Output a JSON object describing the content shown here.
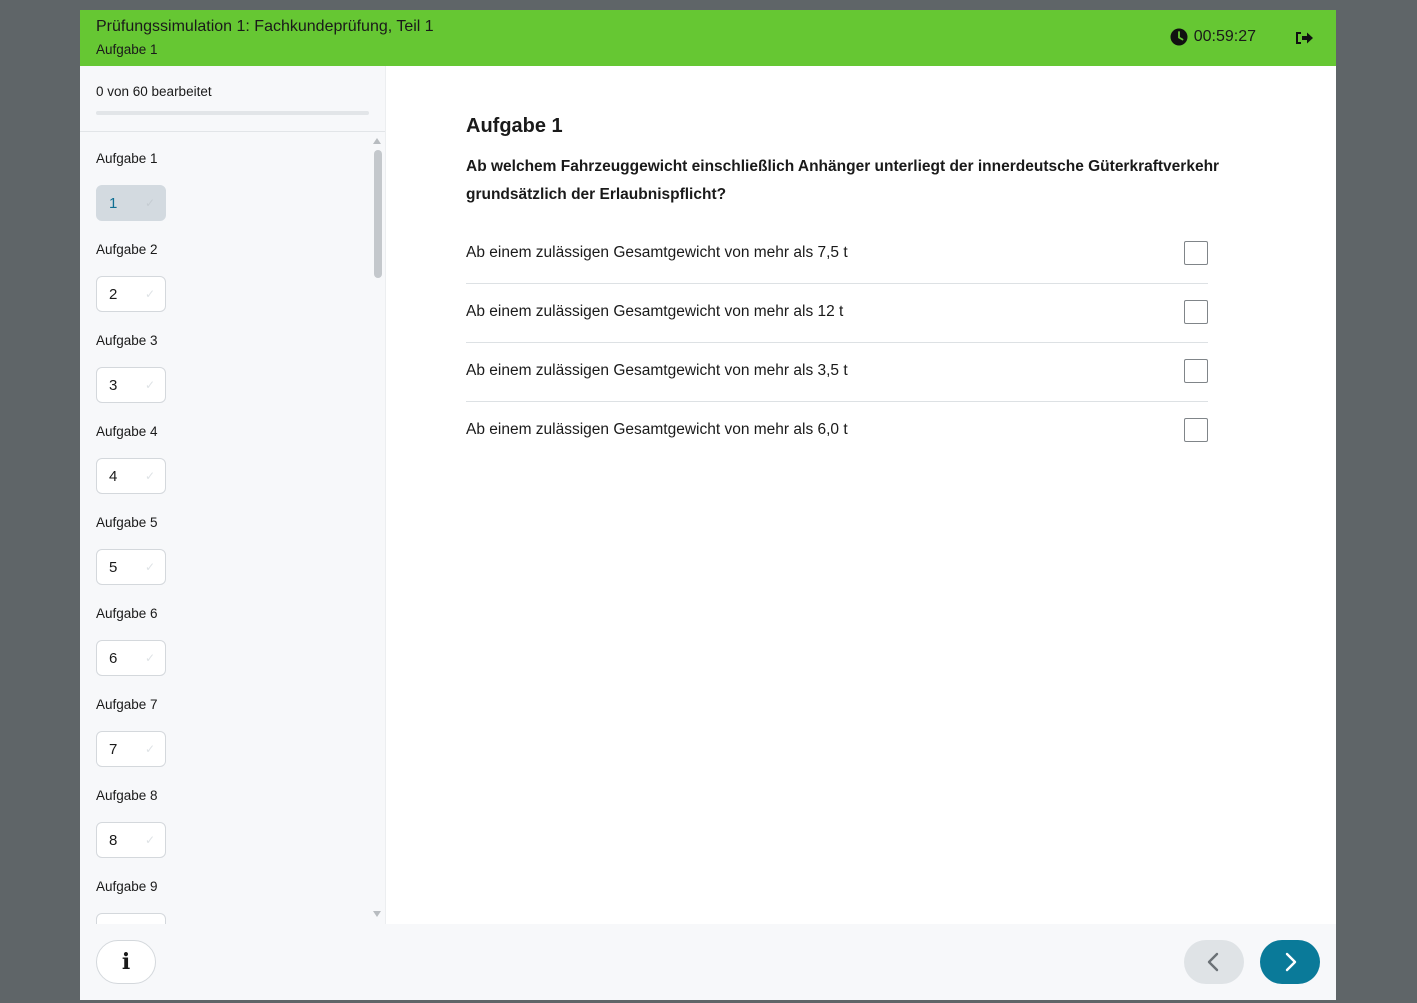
{
  "header": {
    "title": "Prüfungssimulation 1: Fachkundeprüfung, Teil 1",
    "subtitle": "Aufgabe 1",
    "timer": "00:59:27",
    "timer_icon": "clock-icon",
    "exit_icon": "sign-out-icon",
    "color": "#66c733"
  },
  "sidebar": {
    "progress_text": "0 von 60 bearbeitet",
    "progress": 0,
    "tasks": [
      {
        "label": "Aufgabe 1",
        "number": "1",
        "active": true
      },
      {
        "label": "Aufgabe 2",
        "number": "2"
      },
      {
        "label": "Aufgabe 3",
        "number": "3"
      },
      {
        "label": "Aufgabe 4",
        "number": "4"
      },
      {
        "label": "Aufgabe 5",
        "number": "5"
      },
      {
        "label": "Aufgabe 6",
        "number": "6"
      },
      {
        "label": "Aufgabe 7",
        "number": "7"
      },
      {
        "label": "Aufgabe 8",
        "number": "8"
      },
      {
        "label": "Aufgabe 9",
        "number": ""
      }
    ]
  },
  "question": {
    "heading": "Aufgabe 1",
    "text": "Ab welchem Fahrzeuggewicht einschließlich Anhänger unterliegt der innerdeutsche Güterkraftverkehr grundsätzlich der Erlaubnispflicht?",
    "answers": [
      "Ab einem zulässigen Gesamtgewicht von mehr als 7,5 t",
      "Ab einem zulässigen Gesamtgewicht von mehr als 12 t",
      "Ab einem zulässigen Gesamtgewicht von mehr als 3,5 t",
      "Ab einem zulässigen Gesamtgewicht von mehr als 6,0 t"
    ]
  },
  "footer": {
    "info_label": "i",
    "prev_icon": "chevron-left-icon",
    "next_icon": "chevron-right-icon",
    "next_color": "#0a7a99"
  }
}
